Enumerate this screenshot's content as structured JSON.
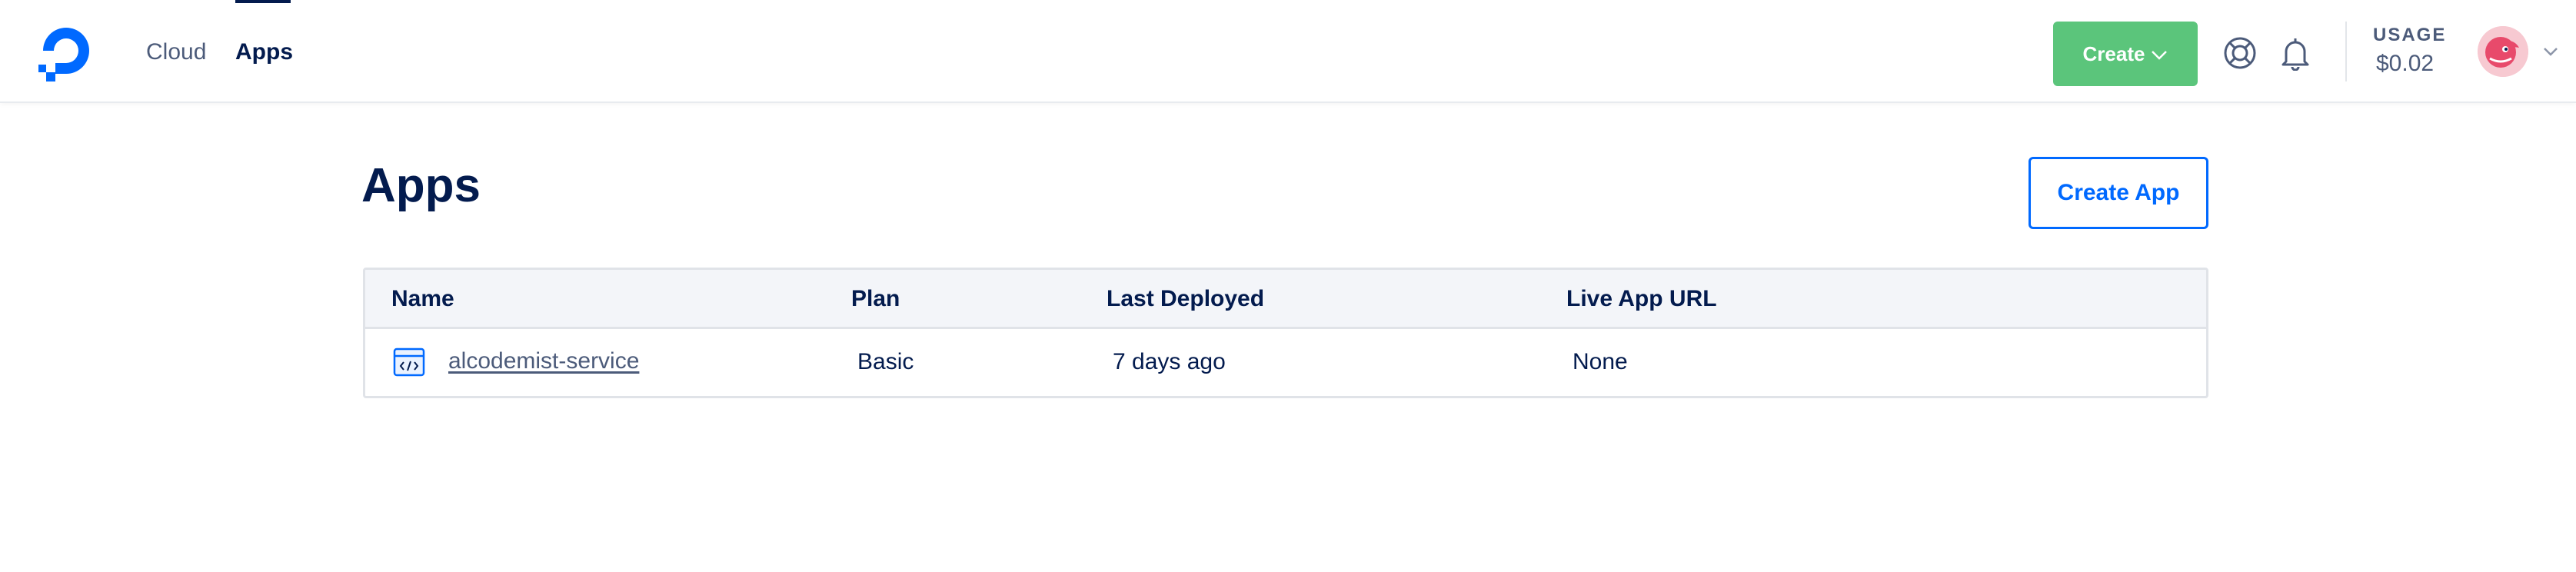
{
  "nav": {
    "items": [
      {
        "label": "Cloud"
      },
      {
        "label": "Apps"
      }
    ],
    "active": "Apps"
  },
  "header": {
    "create_label": "Create",
    "usage_label": "USAGE",
    "usage_value": "$0.02",
    "icons": [
      "digitalocean-logo-icon",
      "chevron-down-icon",
      "help-lifebuoy-icon",
      "bell-icon",
      "avatar",
      "chevron-down-icon"
    ]
  },
  "page": {
    "title": "Apps",
    "create_app_label": "Create App"
  },
  "table": {
    "columns": [
      "Name",
      "Plan",
      "Last Deployed",
      "Live App URL"
    ],
    "rows": [
      {
        "name": "alcodemist-service",
        "plan": "Basic",
        "last_deployed": "7 days ago",
        "live_url": "None",
        "icon": "app-code-icon"
      }
    ]
  },
  "colors": {
    "brand": "#0069ff",
    "create_green": "#5bc57b",
    "text_dark": "#031b4e",
    "text_muted": "#4c5b7a"
  }
}
